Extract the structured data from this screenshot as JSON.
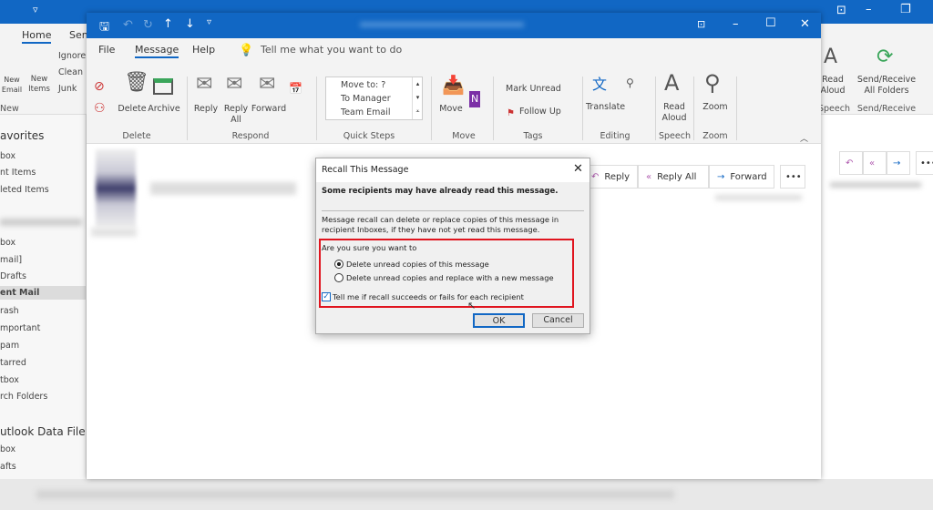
{
  "main_window": {
    "tabs": [
      "Home",
      "Send"
    ],
    "ribbon": {
      "ignore": "Ignore",
      "clean_up": "Clean",
      "junk": "Junk",
      "new_email": "New Email",
      "new_items": "New Items",
      "group_new": "New",
      "read_aloud": "Read Aloud",
      "group_speech": "Speech",
      "send_receive": "Send/Receive All Folders",
      "group_send_receive": "Send/Receive"
    },
    "sidebar": {
      "favorites": "avorites",
      "items": [
        "box",
        "nt Items",
        "leted Items"
      ],
      "account_items": [
        "box",
        "mail]",
        "Drafts",
        "ent Mail",
        "rash",
        "mportant",
        "pam",
        "tarred",
        "tbox",
        "rch Folders"
      ],
      "selected": "ent Mail",
      "data_file": "utlook Data File",
      "data_items": [
        "box",
        "afts"
      ]
    }
  },
  "message_window": {
    "tabs": [
      "File",
      "Message",
      "Help"
    ],
    "active_tab": "Message",
    "tell_me": "Tell me what you want to do",
    "ribbon": {
      "delete": "Delete",
      "archive": "Archive",
      "group_delete": "Delete",
      "reply": "Reply",
      "reply_all": "Reply All",
      "forward": "Forward",
      "group_respond": "Respond",
      "quick_steps": [
        "Move to: ?",
        "To Manager",
        "Team Email"
      ],
      "group_quick_steps": "Quick Steps",
      "move": "Move",
      "group_move": "Move",
      "mark_unread": "Mark Unread",
      "follow_up": "Follow Up",
      "group_tags": "Tags",
      "translate": "Translate",
      "group_editing": "Editing",
      "read_aloud": "Read Aloud",
      "group_speech": "Speech",
      "zoom": "Zoom",
      "group_zoom": "Zoom"
    },
    "actions": {
      "reply": "Reply",
      "reply_all": "Reply All",
      "forward": "Forward",
      "more": "•••"
    }
  },
  "dialog": {
    "title": "Recall This Message",
    "warning": "Some recipients may have already read this message.",
    "description": "Message recall can delete or replace copies of this message in recipient Inboxes, if they have not yet read this message.",
    "question": "Are you sure you want to",
    "options": [
      "Delete unread copies of this message",
      "Delete unread copies and replace with a new message"
    ],
    "selected_option": 0,
    "checkbox_label": "Tell me if recall succeeds or fails for each recipient",
    "checkbox_checked": true,
    "ok": "OK",
    "cancel": "Cancel",
    "highlight_color": "#e0141e"
  }
}
